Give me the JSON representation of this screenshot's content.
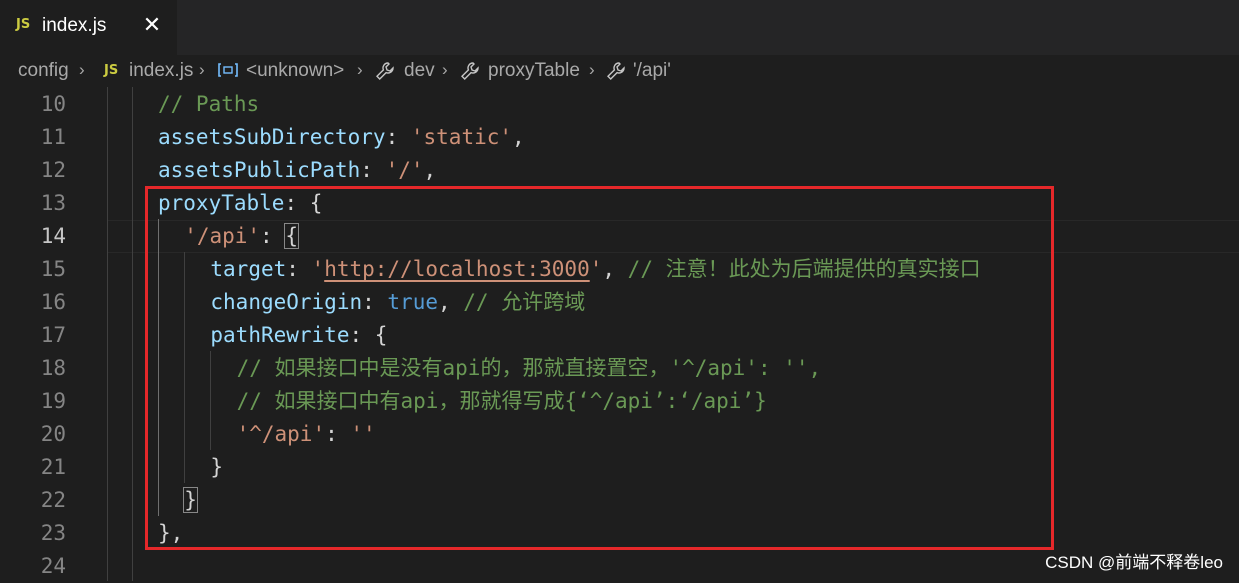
{
  "tab": {
    "icon": "js-file-icon",
    "badge": "JS",
    "label": "index.js",
    "close": "✕"
  },
  "breadcrumb": {
    "folder": "config",
    "file_badge": "JS",
    "file": "index.js",
    "unknown": "<unknown>",
    "dev": "dev",
    "proxyTable": "proxyTable",
    "api": "'/api'"
  },
  "lines": [
    {
      "num": "10",
      "indent": "",
      "code": [
        {
          "c": "com",
          "t": "// Paths"
        }
      ]
    },
    {
      "num": "11",
      "indent": "",
      "code": [
        {
          "c": "prop",
          "t": "assetsSubDirectory"
        },
        {
          "c": "punc",
          "t": ": "
        },
        {
          "c": "str",
          "t": "'static'"
        },
        {
          "c": "punc",
          "t": ","
        }
      ]
    },
    {
      "num": "12",
      "indent": "",
      "code": [
        {
          "c": "prop",
          "t": "assetsPublicPath"
        },
        {
          "c": "punc",
          "t": ": "
        },
        {
          "c": "str",
          "t": "'/'"
        },
        {
          "c": "punc",
          "t": ","
        }
      ]
    },
    {
      "num": "13",
      "indent": "",
      "code": [
        {
          "c": "prop",
          "t": "proxyTable"
        },
        {
          "c": "punc",
          "t": ": {"
        }
      ]
    },
    {
      "num": "14",
      "indent": "  ",
      "code": [
        {
          "c": "str",
          "t": "'/api'"
        },
        {
          "c": "punc",
          "t": ": "
        },
        {
          "c": "hl",
          "t": "{"
        }
      ]
    },
    {
      "num": "15",
      "indent": "    ",
      "code": [
        {
          "c": "prop",
          "t": "target"
        },
        {
          "c": "punc",
          "t": ": "
        },
        {
          "c": "str",
          "t": "'"
        },
        {
          "c": "url",
          "t": "http://localhost:3000"
        },
        {
          "c": "str",
          "t": "'"
        },
        {
          "c": "punc",
          "t": ", "
        },
        {
          "c": "com",
          "t": "// 注意！此处为后端提供的真实接口"
        }
      ]
    },
    {
      "num": "16",
      "indent": "    ",
      "code": [
        {
          "c": "prop",
          "t": "changeOrigin"
        },
        {
          "c": "punc",
          "t": ": "
        },
        {
          "c": "kw",
          "t": "true"
        },
        {
          "c": "punc",
          "t": ", "
        },
        {
          "c": "com",
          "t": "// 允许跨域"
        }
      ]
    },
    {
      "num": "17",
      "indent": "    ",
      "code": [
        {
          "c": "prop",
          "t": "pathRewrite"
        },
        {
          "c": "punc",
          "t": ": {"
        }
      ]
    },
    {
      "num": "18",
      "indent": "      ",
      "code": [
        {
          "c": "com",
          "t": "// 如果接口中是没有api的，那就直接置空，'^/api': '',"
        }
      ]
    },
    {
      "num": "19",
      "indent": "      ",
      "code": [
        {
          "c": "com",
          "t": "// 如果接口中有api，那就得写成{‘^/api’:‘/api’}"
        }
      ]
    },
    {
      "num": "20",
      "indent": "      ",
      "code": [
        {
          "c": "str",
          "t": "'^/api'"
        },
        {
          "c": "punc",
          "t": ": "
        },
        {
          "c": "str",
          "t": "''"
        }
      ]
    },
    {
      "num": "21",
      "indent": "    ",
      "code": [
        {
          "c": "punc",
          "t": "}"
        }
      ]
    },
    {
      "num": "22",
      "indent": "  ",
      "code": [
        {
          "c": "hl",
          "t": "}"
        }
      ]
    },
    {
      "num": "23",
      "indent": "",
      "code": [
        {
          "c": "punc",
          "t": "},"
        }
      ]
    },
    {
      "num": "24",
      "indent": "",
      "code": []
    }
  ],
  "active_line": "14",
  "watermark": "CSDN @前端不释卷leo",
  "colors": {
    "highlight_box": "#e5282a",
    "background": "#1e1e1e"
  }
}
